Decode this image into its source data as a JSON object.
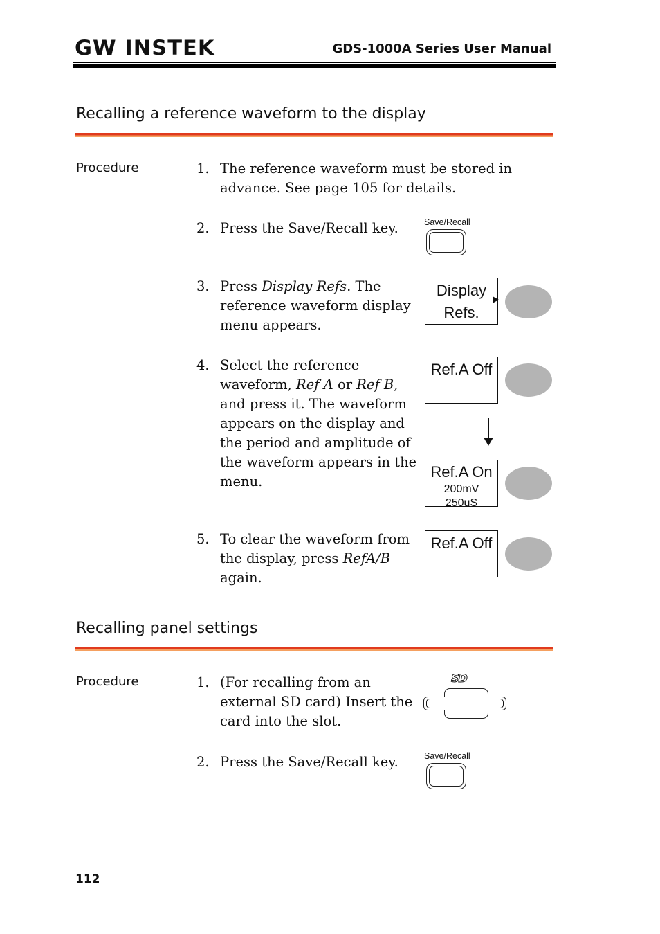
{
  "header": {
    "logo": "GW INSTEK",
    "manual_title": "GDS-1000A Series User Manual"
  },
  "section1": {
    "title": "Recalling a reference waveform to the display",
    "label": "Procedure",
    "steps": [
      {
        "num": "1.",
        "text": "The reference waveform must be stored in advance. See page 105 for details."
      },
      {
        "num": "2.",
        "text": "Press the Save/Recall key."
      },
      {
        "num": "3.",
        "pre": "Press ",
        "em": "Display Refs",
        "post": ". The reference waveform display menu appears."
      },
      {
        "num": "4.",
        "pre": "Select the reference waveform, ",
        "em": "Ref A",
        "mid": " or ",
        "em2": "Ref B",
        "post": ", and press it. The waveform appears on the display and the period and amplitude of the waveform appears in the menu."
      },
      {
        "num": "5.",
        "pre": "To clear the waveform from the display, press ",
        "em": "RefA/B",
        "post": " again."
      }
    ],
    "save_recall_key_label": "Save/Recall",
    "display_refs_line1": "Display",
    "display_refs_line2": "Refs.",
    "ref_a_off": "Ref.A Off",
    "ref_a_on": "Ref.A On",
    "ref_a_amplitude": "200mV",
    "ref_a_period": "250uS",
    "ref_a_off_again": "Ref.A Off"
  },
  "section2": {
    "title": "Recalling panel settings",
    "label": "Procedure",
    "steps": [
      {
        "num": "1.",
        "text": "(For recalling from an external SD card) Insert the card into the slot."
      },
      {
        "num": "2.",
        "text": "Press the Save/Recall key."
      }
    ],
    "sd_logo": "SD",
    "save_recall_key_label": "Save/Recall"
  },
  "footer": {
    "page_number": "112"
  },
  "colors": {
    "section_rule_top": "#e03a1e",
    "section_rule_bottom": "#f5a060",
    "soft_button": "#b4b4b4"
  }
}
